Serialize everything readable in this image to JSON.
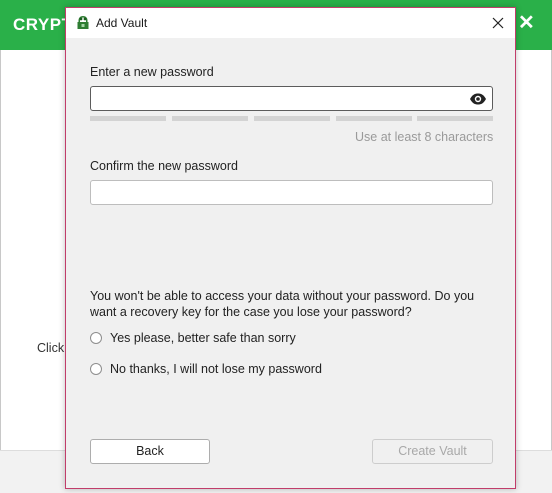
{
  "background_app": {
    "title": "CRYPTO",
    "click_text": "Click",
    "close_glyph": "✕",
    "accent_color": "#2ab049"
  },
  "dialog": {
    "title": "Add Vault",
    "icon": "cryptomator-icon",
    "close_glyph": "✕",
    "border_color": "#c13d6a"
  },
  "form": {
    "new_password_label": "Enter a new password",
    "new_password_value": "",
    "strength_segments": 5,
    "strength_level": 0,
    "password_hint": "Use at least 8 characters",
    "confirm_password_label": "Confirm the new password",
    "confirm_password_value": "",
    "recovery_question": "You won't be able to access your data without your password. Do you want a recovery key for the case you lose your password?",
    "recovery_options": [
      {
        "label": "Yes please, better safe than sorry",
        "selected": false
      },
      {
        "label": "No thanks, I will not lose my password",
        "selected": false
      }
    ]
  },
  "buttons": {
    "back_label": "Back",
    "create_label": "Create Vault",
    "create_enabled": false
  }
}
